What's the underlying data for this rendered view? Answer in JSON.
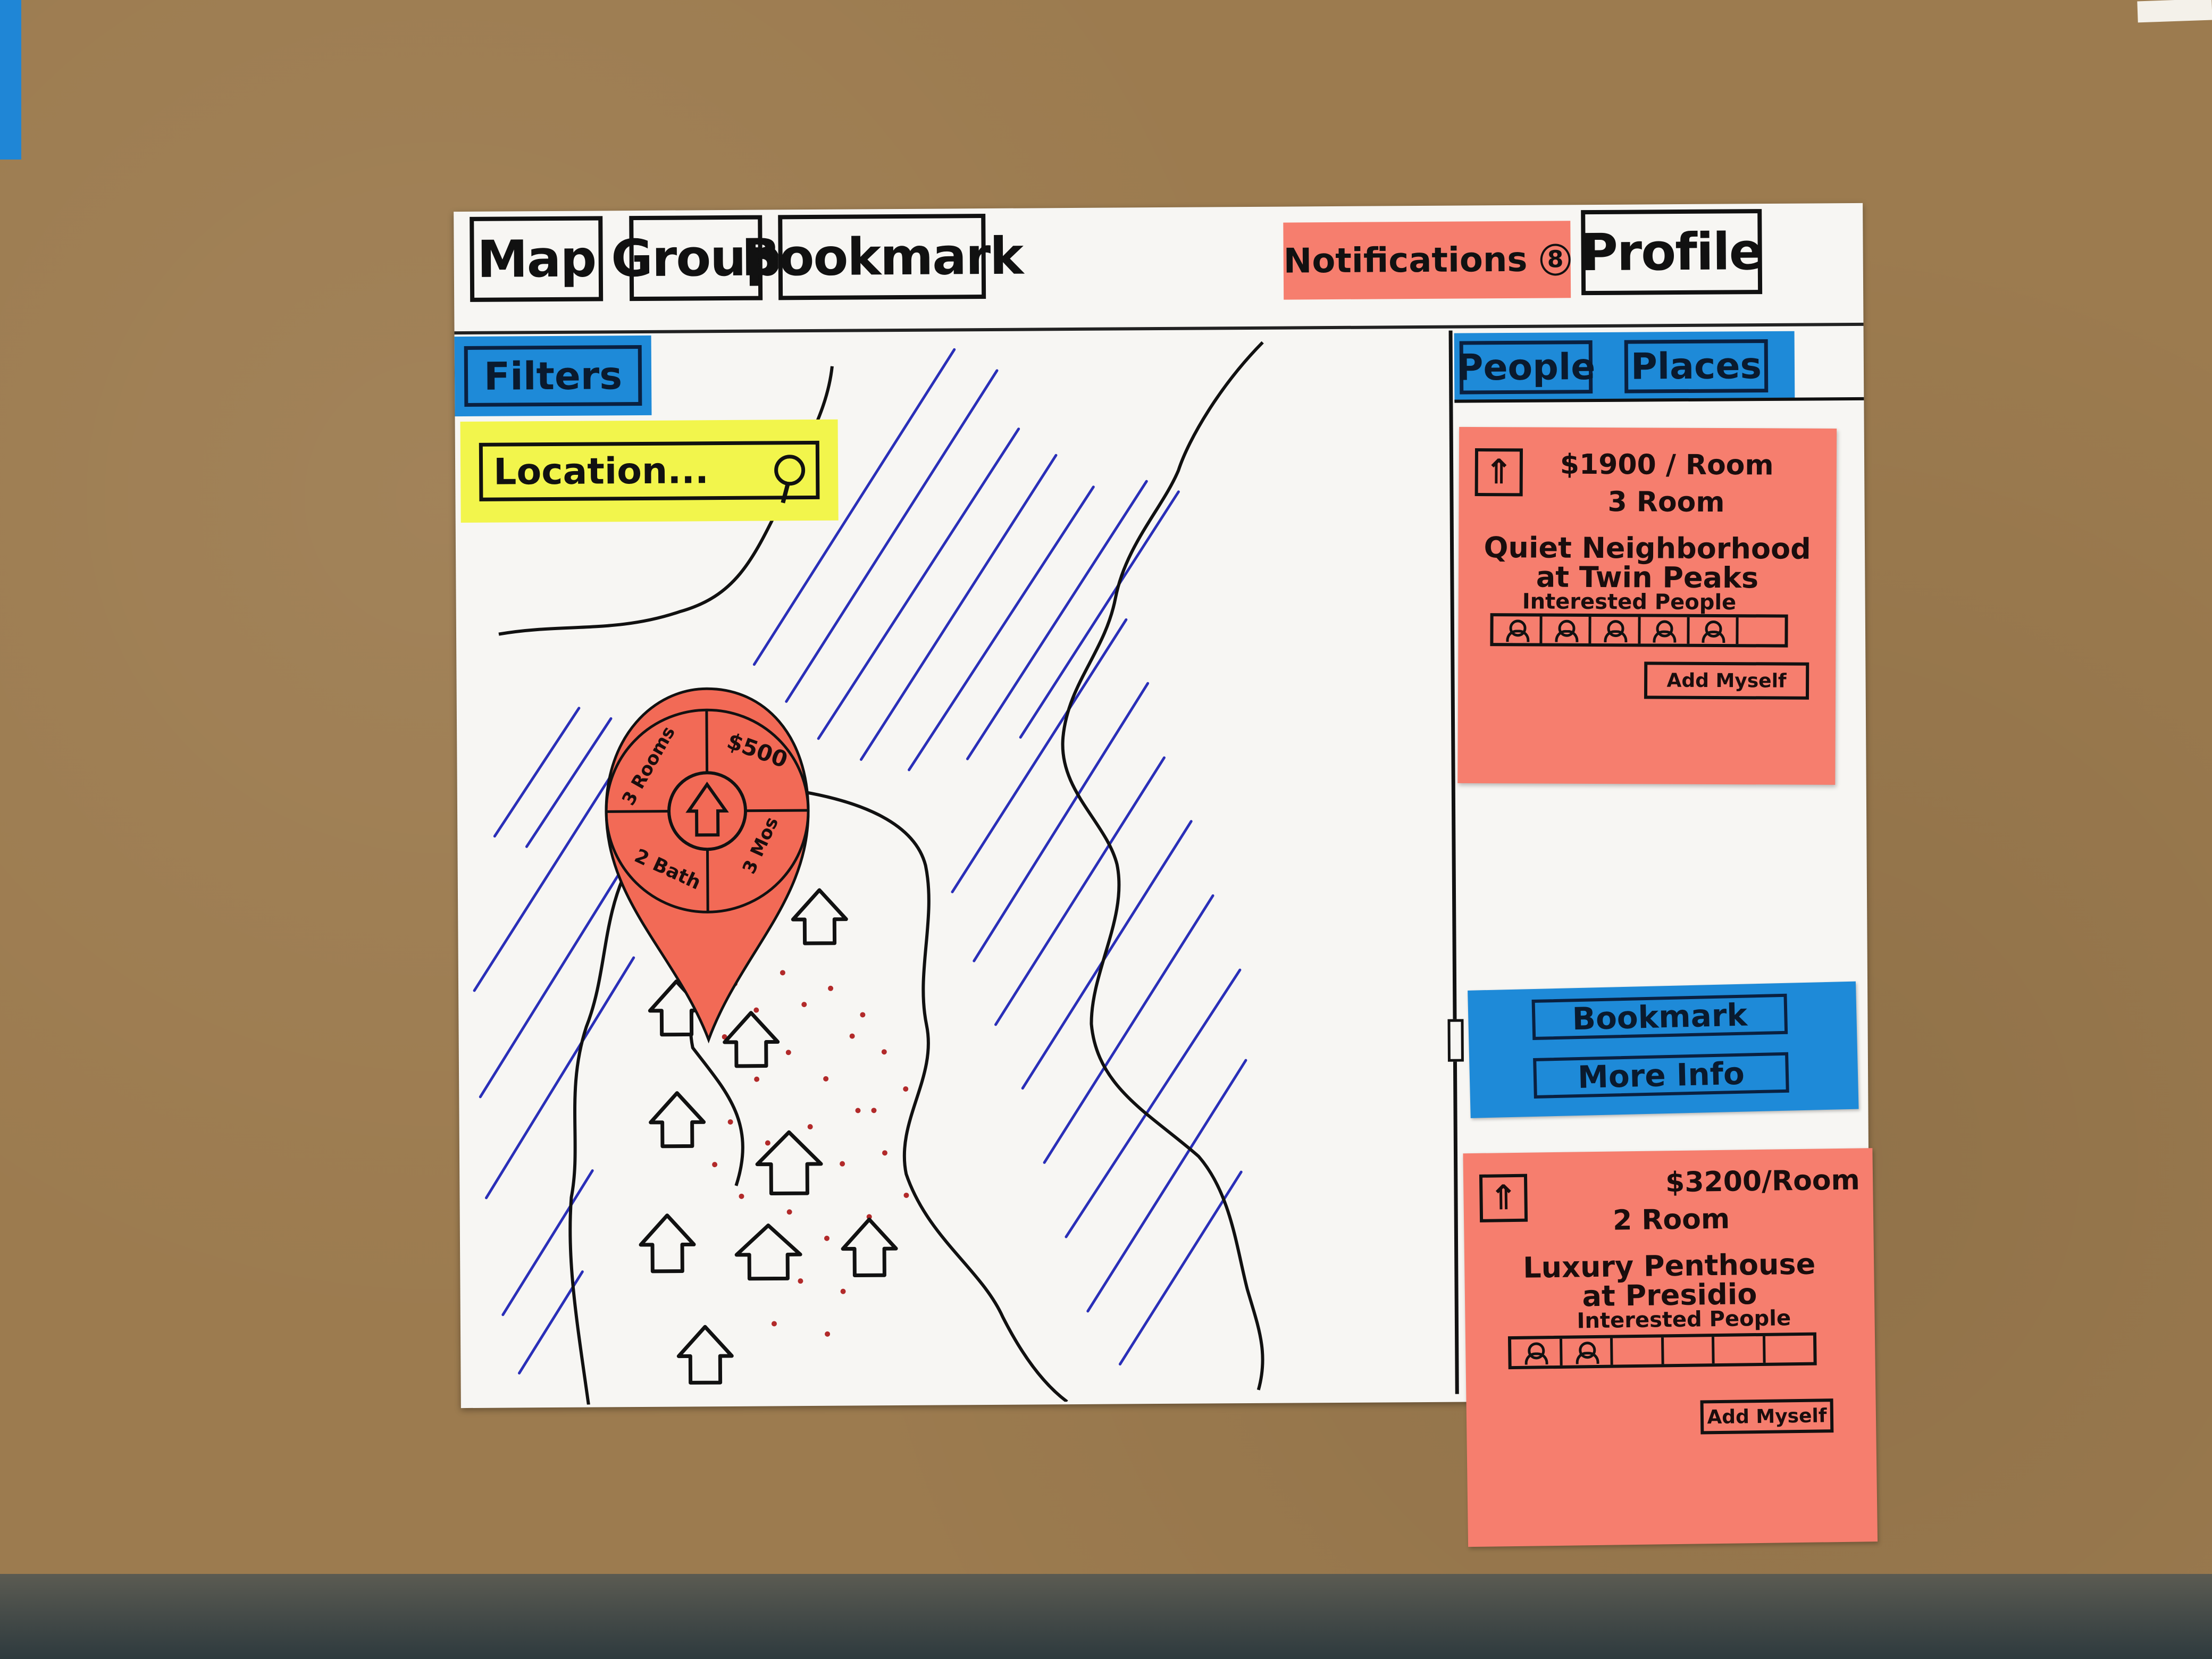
{
  "nav": {
    "map": "Map",
    "group": "Group",
    "bookmark": "Bookmark",
    "notifications": "Notifications",
    "notification_count": "8",
    "profile": "Profile"
  },
  "filters": {
    "label": "Filters"
  },
  "search": {
    "value": "Location..."
  },
  "pin": {
    "price": "$500",
    "rooms": "3 Rooms",
    "bath": "2 Bath",
    "months": "3 Mos"
  },
  "panel_tabs": {
    "people": "People",
    "places": "Places"
  },
  "listings": [
    {
      "price": "$1900 / Room",
      "rooms": "3 Room",
      "desc_line1": "Quiet Neighborhood",
      "desc_line2": "at Twin Peaks",
      "interested_label": "Interested People",
      "interested_filled": 5,
      "interested_total": 6,
      "add_label": "Add Myself"
    },
    {
      "price": "$3200/Room",
      "rooms": "2 Room",
      "desc_line1": "Luxury Penthouse",
      "desc_line2": "at Presidio",
      "interested_label": "Interested People",
      "interested_filled": 2,
      "interested_total": 6,
      "add_label": "Add Myself"
    }
  ],
  "actions": {
    "bookmark": "Bookmark",
    "more_info": "More Info"
  },
  "colors": {
    "sticky_red": "#f67e6e",
    "sticky_blue": "#1e8ad8",
    "sticky_yellow": "#f2f54c",
    "paper": "#f7f6f3",
    "water_lines": "#2a2fb8",
    "crowd_dots": "#b22a2a"
  }
}
